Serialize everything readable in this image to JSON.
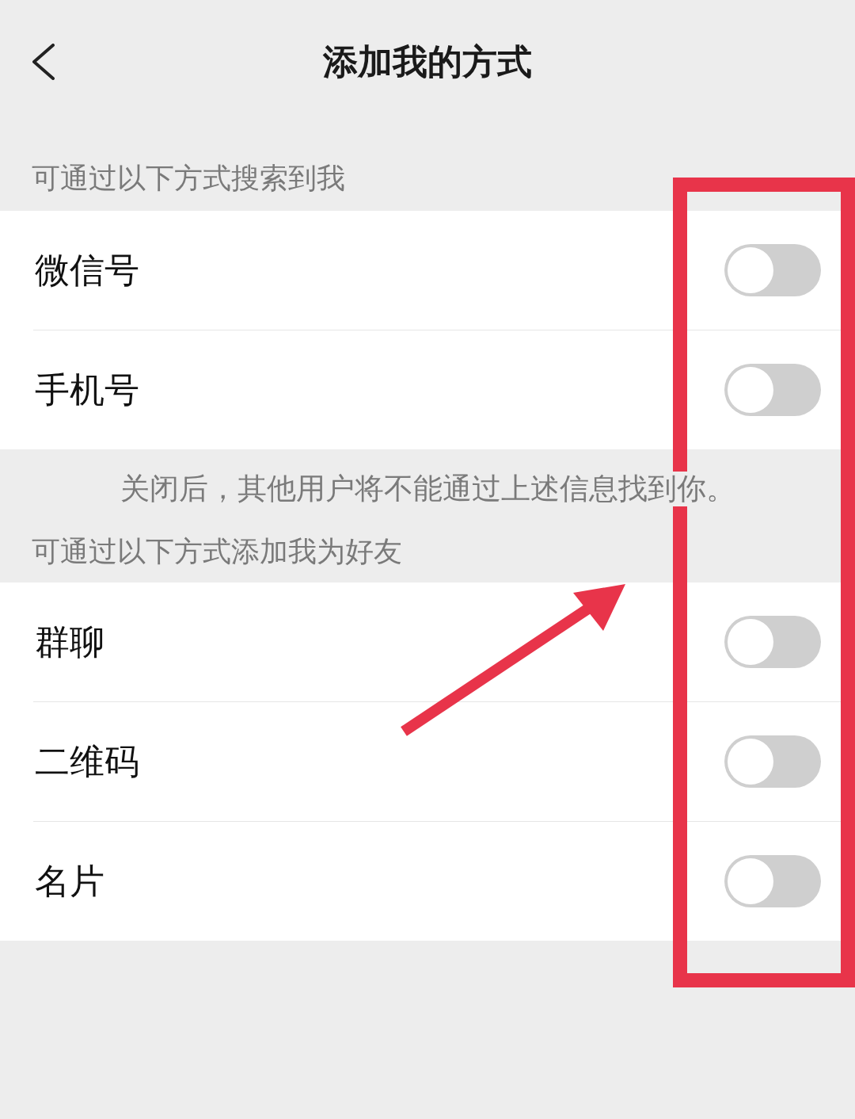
{
  "nav": {
    "title": "添加我的方式"
  },
  "sections": [
    {
      "header": "可通过以下方式搜索到我",
      "items": [
        {
          "label": "微信号",
          "on": false
        },
        {
          "label": "手机号",
          "on": false
        }
      ],
      "note": "关闭后，其他用户将不能通过上述信息找到你。"
    },
    {
      "header": "可通过以下方式添加我为好友",
      "items": [
        {
          "label": "群聊",
          "on": false
        },
        {
          "label": "二维码",
          "on": false
        },
        {
          "label": "名片",
          "on": false
        }
      ]
    }
  ]
}
